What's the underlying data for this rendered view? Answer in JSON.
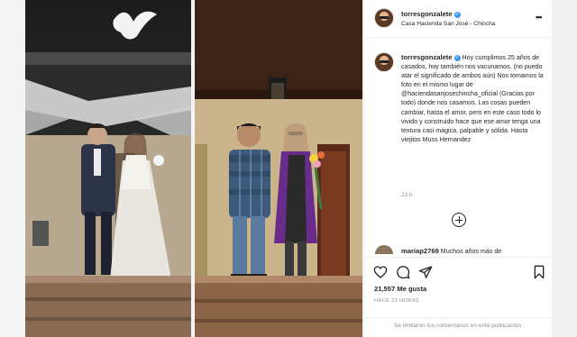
{
  "header": {
    "username": "torresgonzalete",
    "location": "Casa Hacienda San José - Chincha"
  },
  "caption": {
    "username": "torresgonzalete",
    "text": "Hoy cumplimos 25 años de casados, hoy también nos vacunamos. (no puedo atar el significado de ambos aún) Nos tomamos la foto en el mismo lugar de @haciendasanjosechincha_oficial (Gracias por todo) donde nos casamos. Las cosas pueden cambiar, hasta el amor, pero en este caso todo lo vivido y construido hace que ese amor tenga una textura casi mágica, palpable y sólida. Hasta viejitos Muss Hernandez",
    "time": "23 h"
  },
  "comment": {
    "username": "mariap2769",
    "text": "Muchos años más de"
  },
  "actions": {
    "likes": "21,557 Me gusta",
    "posted_ago": "HACE 23 HORAS",
    "comments_disabled": "Se limitaron los comentarios en esta publicación."
  },
  "icons": {
    "header_more": "more-horizontal-icon",
    "verified": "verified-badge-icon",
    "like": "heart-icon",
    "comment": "comment-bubble-icon",
    "share": "paper-plane-icon",
    "save": "bookmark-icon",
    "load_more": "plus-circle-icon"
  },
  "colors": {
    "verified": "#3897f0",
    "text": "#262626",
    "muted": "#8e8e8e",
    "border": "#efefef"
  }
}
